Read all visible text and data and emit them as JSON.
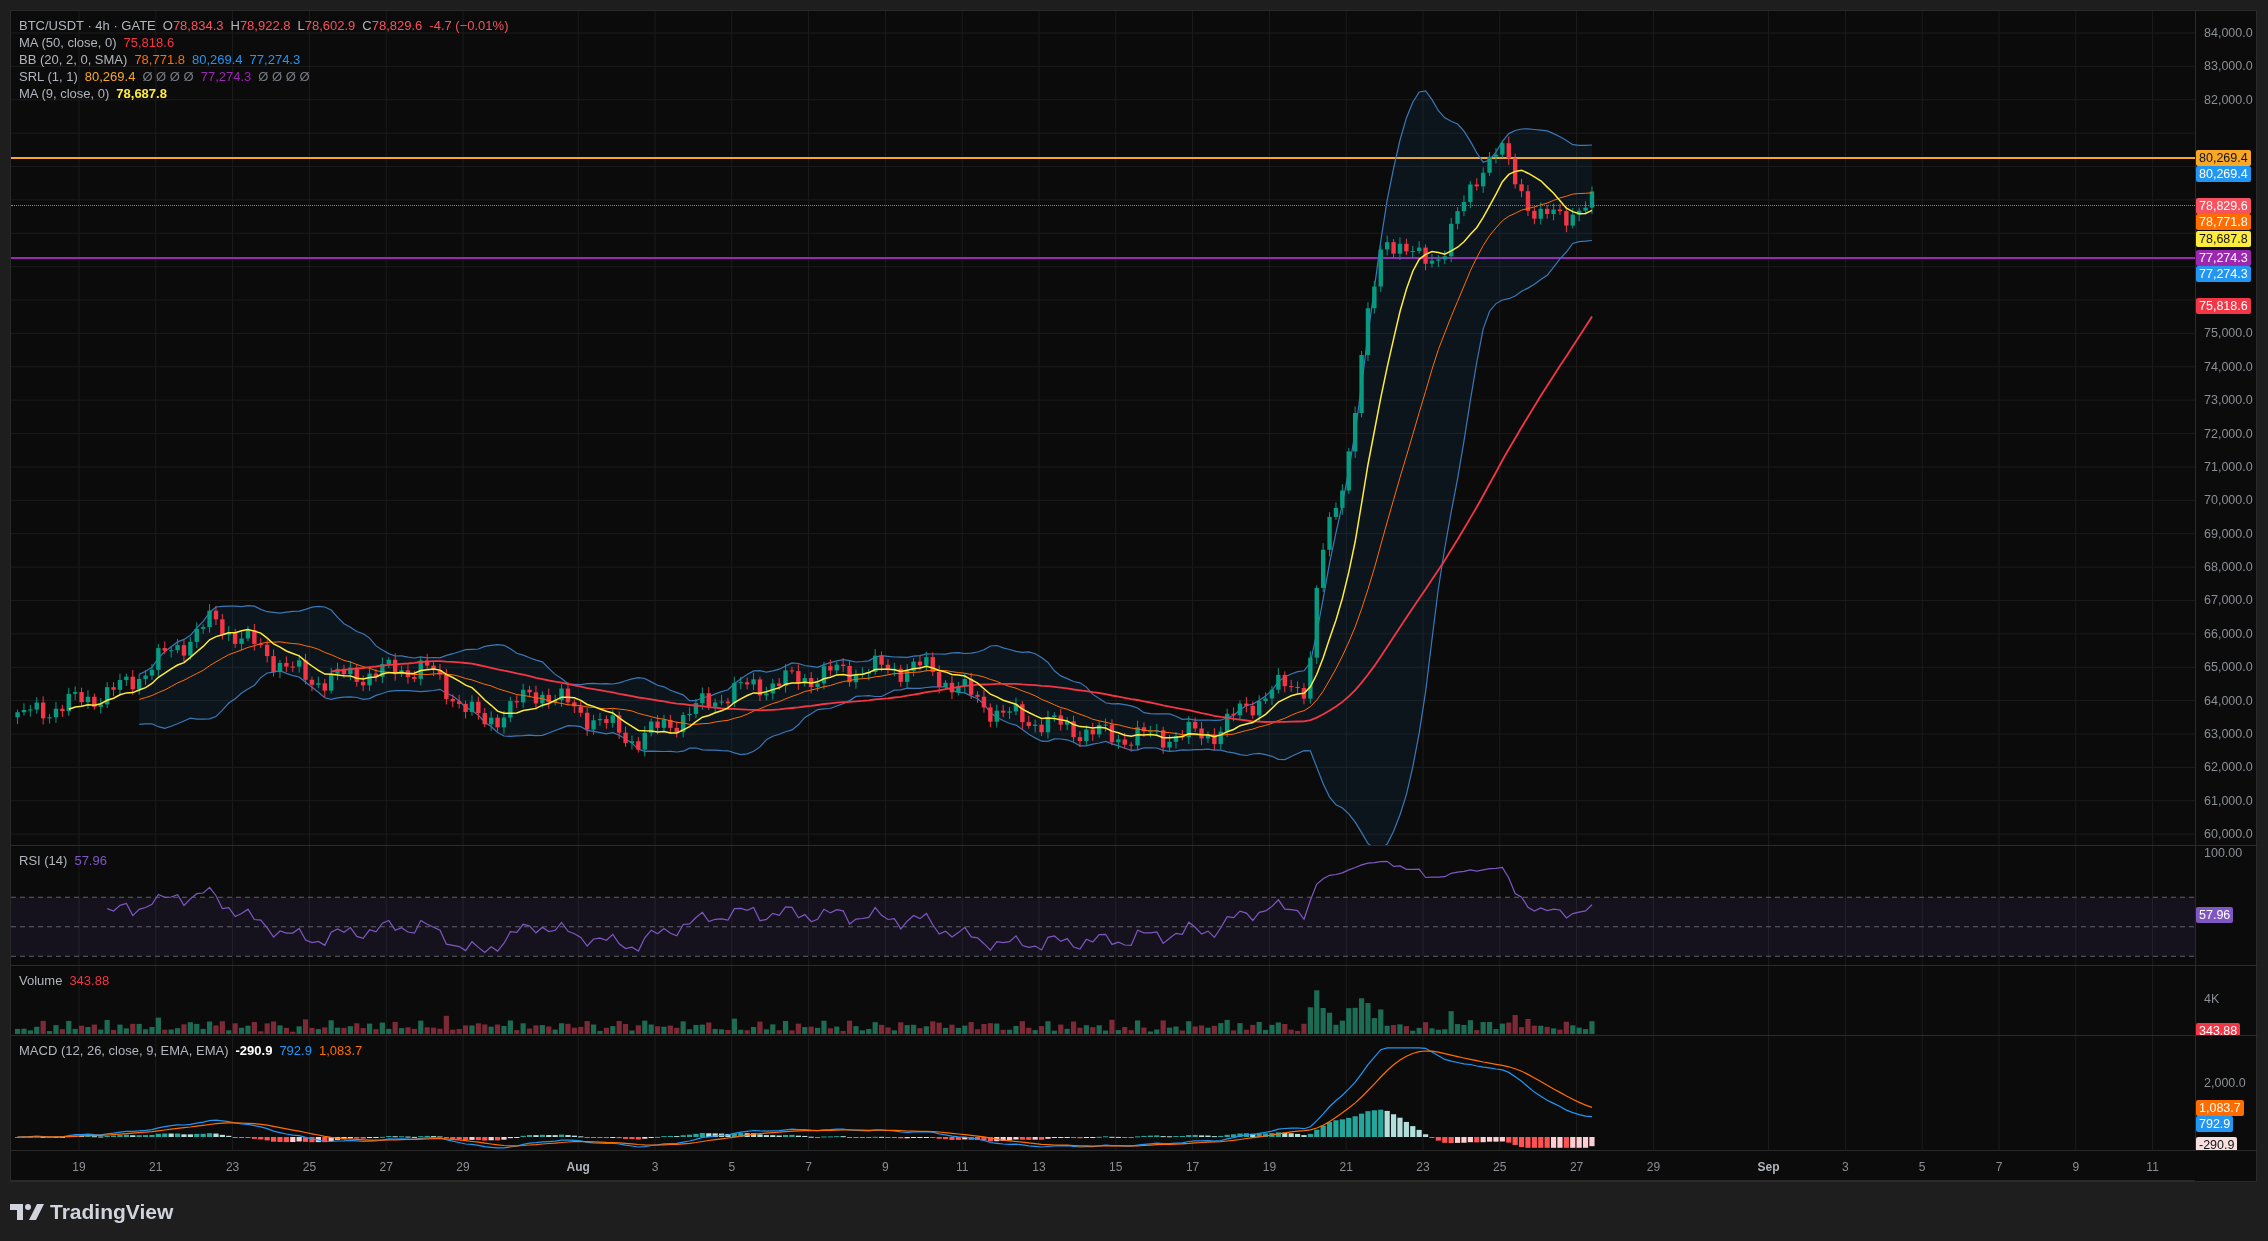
{
  "legend": {
    "symbol": "BTC/USDT · 4h · GATE",
    "ohlc": [
      {
        "label": "O",
        "value": "78,834.3"
      },
      {
        "label": "H",
        "value": "78,922.8"
      },
      {
        "label": "L",
        "value": "78,602.9"
      },
      {
        "label": "C",
        "value": "78,829.6"
      }
    ],
    "change": "-4.7 (−0.01%)",
    "indicators": [
      {
        "name": "MA (50, close, 0)",
        "values": [
          {
            "text": "75,818.6",
            "color": "#f23645"
          }
        ]
      },
      {
        "name": "BB (20, 2, 0, SMA)",
        "values": [
          {
            "text": "78,771.8",
            "color": "#ff6d00"
          },
          {
            "text": "80,269.4",
            "color": "#2196f3"
          },
          {
            "text": "77,274.3",
            "color": "#2196f3"
          }
        ]
      },
      {
        "name": "SRL (1, 1)",
        "values": [
          {
            "text": "80,269.4",
            "color": "#f9a825"
          },
          {
            "text": "Ø Ø Ø Ø",
            "color": "#787b86"
          },
          {
            "text": "77,274.3",
            "color": "#9c27b0"
          },
          {
            "text": "Ø Ø Ø Ø",
            "color": "#787b86"
          }
        ]
      },
      {
        "name": "MA (9, close, 0)",
        "values": [
          {
            "text": "78,687.8",
            "color": "#ffeb3b",
            "bold": true
          }
        ]
      }
    ]
  },
  "price_axis": {
    "ticks": [
      "84,000.0",
      "83,000.0",
      "82,000.0",
      "75,000.0",
      "74,000.0",
      "73,000.0",
      "72,000.0",
      "71,000.0",
      "70,000.0",
      "69,000.0",
      "68,000.0",
      "67,000.0",
      "66,000.0",
      "65,000.0",
      "64,000.0",
      "63,000.0",
      "62,000.0",
      "61,000.0",
      "60,000.0"
    ],
    "tags": [
      {
        "text": "80,269.4",
        "color": "#f9a825",
        "line": true
      },
      {
        "text": "80,269.4",
        "color": "#2196f3"
      },
      {
        "text": "78,829.6",
        "color": "#f7525f",
        "line": true,
        "dotted": true
      },
      {
        "text": "78,771.8",
        "color": "#ff6d00"
      },
      {
        "text": "78,687.8",
        "color": "#ffeb3b"
      },
      {
        "text": "77,274.3",
        "color": "#9c27b0",
        "line": true
      },
      {
        "text": "77,274.3",
        "color": "#2196f3"
      },
      {
        "text": "75,818.6",
        "color": "#f23645"
      }
    ]
  },
  "rsi": {
    "name": "RSI (14)",
    "values": [
      {
        "text": "57.96",
        "color": "#7e57c2"
      }
    ],
    "ticks": [
      "100.00"
    ],
    "tags": [
      {
        "text": "57.96",
        "color": "#7e57c2"
      }
    ]
  },
  "volume": {
    "name": "Volume",
    "values": [
      {
        "text": "343.88",
        "color": "#f23645"
      }
    ],
    "ticks": [
      "4K"
    ],
    "tags": [
      {
        "text": "343.88",
        "color": "#f23645"
      }
    ]
  },
  "macd": {
    "name": "MACD (12, 26, close, 9, EMA, EMA)",
    "values": [
      {
        "text": "-290.9",
        "color": "#ffffff",
        "bold": true
      },
      {
        "text": "792.9",
        "color": "#2196f3"
      },
      {
        "text": "1,083.7",
        "color": "#ff6d00"
      }
    ],
    "ticks": [
      "2,000.0"
    ],
    "tags": [
      {
        "text": "1,083.7",
        "color": "#ff6d00"
      },
      {
        "text": "792.9",
        "color": "#2196f3"
      },
      {
        "text": "-290.9",
        "color": "#f8dfe0"
      }
    ]
  },
  "time_axis": [
    {
      "text": "19",
      "kind": "day"
    },
    {
      "text": "21",
      "kind": "day"
    },
    {
      "text": "23",
      "kind": "day"
    },
    {
      "text": "25",
      "kind": "day"
    },
    {
      "text": "27",
      "kind": "day"
    },
    {
      "text": "29",
      "kind": "day"
    },
    {
      "text": "Aug",
      "kind": "month"
    },
    {
      "text": "3",
      "kind": "day"
    },
    {
      "text": "5",
      "kind": "day"
    },
    {
      "text": "7",
      "kind": "day"
    },
    {
      "text": "9",
      "kind": "day"
    },
    {
      "text": "11",
      "kind": "day"
    },
    {
      "text": "13",
      "kind": "day"
    },
    {
      "text": "15",
      "kind": "day"
    },
    {
      "text": "17",
      "kind": "day"
    },
    {
      "text": "19",
      "kind": "day"
    },
    {
      "text": "21",
      "kind": "day"
    },
    {
      "text": "23",
      "kind": "day"
    },
    {
      "text": "25",
      "kind": "day"
    },
    {
      "text": "27",
      "kind": "day"
    },
    {
      "text": "29",
      "kind": "day"
    },
    {
      "text": "Sep",
      "kind": "month"
    },
    {
      "text": "3",
      "kind": "day"
    },
    {
      "text": "5",
      "kind": "day"
    },
    {
      "text": "7",
      "kind": "day"
    },
    {
      "text": "9",
      "kind": "day"
    },
    {
      "text": "11",
      "kind": "day"
    }
  ],
  "footer": {
    "brand": "TradingView"
  }
}
